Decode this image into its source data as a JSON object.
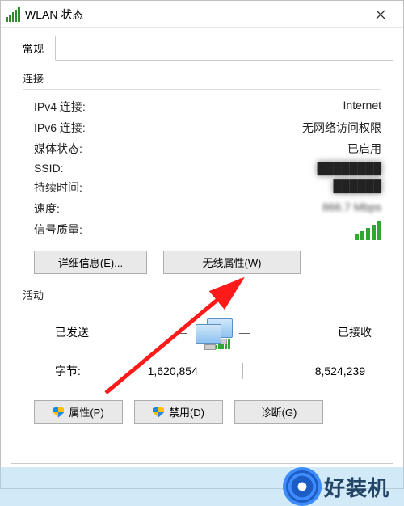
{
  "window": {
    "title": "WLAN 状态",
    "close_icon_name": "close-icon"
  },
  "tabs": {
    "general": "常规"
  },
  "connection": {
    "group_title": "连接",
    "ipv4_label": "IPv4 连接:",
    "ipv4_value": "Internet",
    "ipv6_label": "IPv6 连接:",
    "ipv6_value": "无网络访问权限",
    "media_label": "媒体状态:",
    "media_value": "已启用",
    "ssid_label": "SSID:",
    "ssid_value": "████████",
    "duration_label": "持续时间:",
    "duration_value": "██████",
    "speed_label": "速度:",
    "speed_value": "866.7 Mbps",
    "signal_label": "信号质量:"
  },
  "buttons": {
    "details": "详细信息(E)...",
    "wireless_props": "无线属性(W)",
    "properties": "属性(P)",
    "disable": "禁用(D)",
    "diagnose": "诊断(G)"
  },
  "activity": {
    "group_title": "活动",
    "sent_label": "已发送",
    "received_label": "已接收",
    "bytes_label": "字节:",
    "sent_value": "1,620,854",
    "received_value": "8,524,239"
  },
  "watermark": {
    "text": "好装机"
  }
}
